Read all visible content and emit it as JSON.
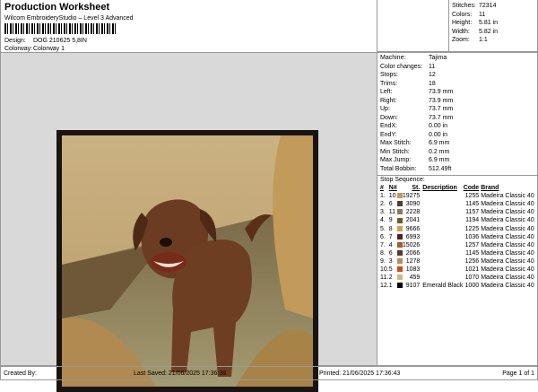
{
  "header": {
    "title": "Production Worksheet",
    "subtitle": "Wilcom EmbroideryStudio – Level 3 Advanced",
    "design_label": "Design:",
    "design": "DOG 210625 5,8IN",
    "colorway_label": "Colorway:",
    "colorway": "Colorway 1"
  },
  "stats": [
    {
      "k": "Stitches:",
      "v": "72314"
    },
    {
      "k": "Colors:",
      "v": "11"
    },
    {
      "k": "Height:",
      "v": "5.81 in"
    },
    {
      "k": "Width:",
      "v": "5.82 in"
    },
    {
      "k": "Zoom:",
      "v": "1:1"
    }
  ],
  "info": [
    {
      "k": "Machine:",
      "v": "Tajima"
    },
    {
      "k": "Color changes:",
      "v": "11"
    },
    {
      "k": "Stops:",
      "v": "12"
    },
    {
      "k": "Trims:",
      "v": "18"
    },
    {
      "k": "Left:",
      "v": "73.9 mm"
    },
    {
      "k": "Right:",
      "v": "73.9 mm"
    },
    {
      "k": "Up:",
      "v": "73.7 mm"
    },
    {
      "k": "Down:",
      "v": "73.7 mm"
    },
    {
      "k": "EndX:",
      "v": "0.00 in"
    },
    {
      "k": "EndY:",
      "v": "0.00 in"
    },
    {
      "k": "Max Stitch:",
      "v": "6.9 mm"
    },
    {
      "k": "Min Stitch:",
      "v": "0.2 mm"
    },
    {
      "k": "Max Jump:",
      "v": "6.9 mm"
    },
    {
      "k": "Total Bobbin:",
      "v": "512.49ft"
    }
  ],
  "stop_sequence": {
    "title": "Stop Sequence:",
    "columns": [
      "#",
      "N#",
      "St.",
      "Description",
      "Code",
      "Brand"
    ],
    "rows": [
      {
        "i": "1.",
        "n": "10",
        "color": "#c8955e",
        "st": "19275",
        "desc": "",
        "code": "1255",
        "brand": "Madeira Classic 40"
      },
      {
        "i": "2.",
        "n": "6",
        "color": "#5a3a2e",
        "st": "3090",
        "desc": "",
        "code": "1145",
        "brand": "Madeira Classic 40"
      },
      {
        "i": "3.",
        "n": "11",
        "color": "#8a7a55",
        "st": "2228",
        "desc": "",
        "code": "1157",
        "brand": "Madeira Classic 40"
      },
      {
        "i": "4.",
        "n": "9",
        "color": "#6e5a2a",
        "st": "2041",
        "desc": "",
        "code": "1194",
        "brand": "Madeira Classic 40"
      },
      {
        "i": "5.",
        "n": "8",
        "color": "#d99a4a",
        "st": "9666",
        "desc": "",
        "code": "1225",
        "brand": "Madeira Classic 40"
      },
      {
        "i": "6.",
        "n": "7",
        "color": "#4a2226",
        "st": "6993",
        "desc": "",
        "code": "1036",
        "brand": "Madeira Classic 40"
      },
      {
        "i": "7.",
        "n": "4",
        "color": "#a85a28",
        "st": "15026",
        "desc": "",
        "code": "1257",
        "brand": "Madeira Classic 40"
      },
      {
        "i": "8.",
        "n": "6",
        "color": "#5a3a2e",
        "st": "2066",
        "desc": "",
        "code": "1145",
        "brand": "Madeira Classic 40"
      },
      {
        "i": "9.",
        "n": "3",
        "color": "#c08a5a",
        "st": "1278",
        "desc": "",
        "code": "1256",
        "brand": "Madeira Classic 40"
      },
      {
        "i": "10.",
        "n": "5",
        "color": "#c84a1e",
        "st": "1083",
        "desc": "",
        "code": "1021",
        "brand": "Madeira Classic 40"
      },
      {
        "i": "11.",
        "n": "2",
        "color": "#ddb27a",
        "st": "459",
        "desc": "",
        "code": "1070",
        "brand": "Madeira Classic 40"
      },
      {
        "i": "12.",
        "n": "1",
        "color": "#000000",
        "st": "9107",
        "desc": "Emerald Black",
        "code": "1000",
        "brand": "Madeira Classic 40"
      }
    ]
  },
  "footer": {
    "created": "Created By:",
    "saved": "Last Saved: 21/06/2025 17:36:38",
    "printed": "Printed: 21/06/2025 17:36:43",
    "page": "Page 1 of 1"
  }
}
